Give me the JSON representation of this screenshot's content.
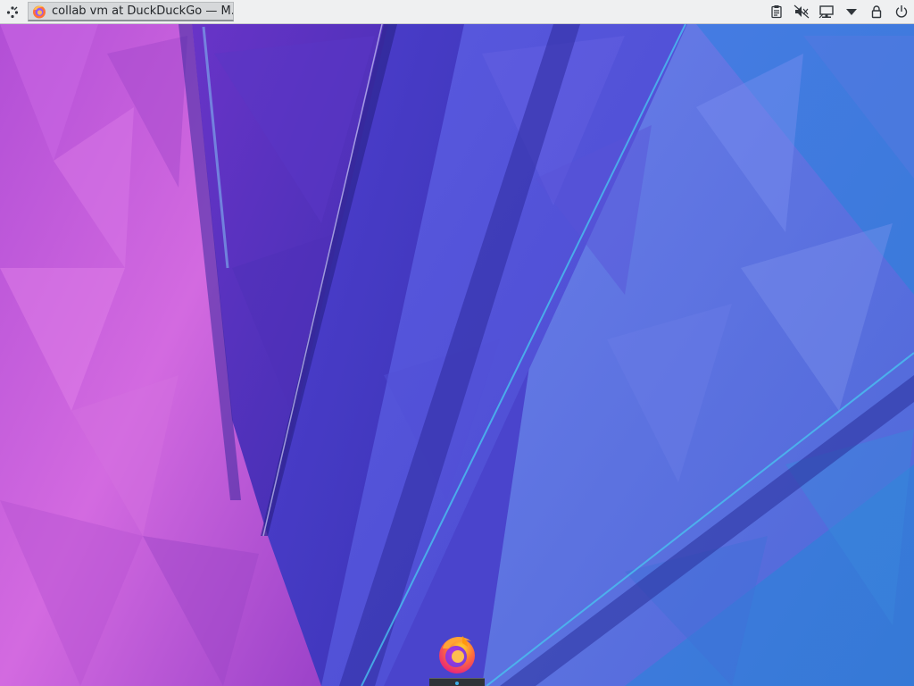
{
  "desktop": {
    "wallpaper": "kde-plasma-polygon-fan",
    "colors": {
      "magenta": "#c85ad8",
      "violet": "#5a3fc9",
      "blue": "#4c6ce0",
      "accent_line": "#3daee9"
    }
  },
  "panel": {
    "launcher_icon": "application-launcher-icon",
    "task": {
      "icon": "firefox-icon",
      "title": "collab vm at DuckDuckGo — M..."
    },
    "tray": [
      {
        "name": "clipboard-icon"
      },
      {
        "name": "volume-muted-icon"
      },
      {
        "name": "network-icon"
      },
      {
        "name": "tray-expand-icon"
      },
      {
        "name": "lock-screen-icon"
      },
      {
        "name": "power-icon"
      }
    ]
  },
  "dock": {
    "items": [
      {
        "name": "firefox-icon",
        "active": true
      }
    ]
  }
}
